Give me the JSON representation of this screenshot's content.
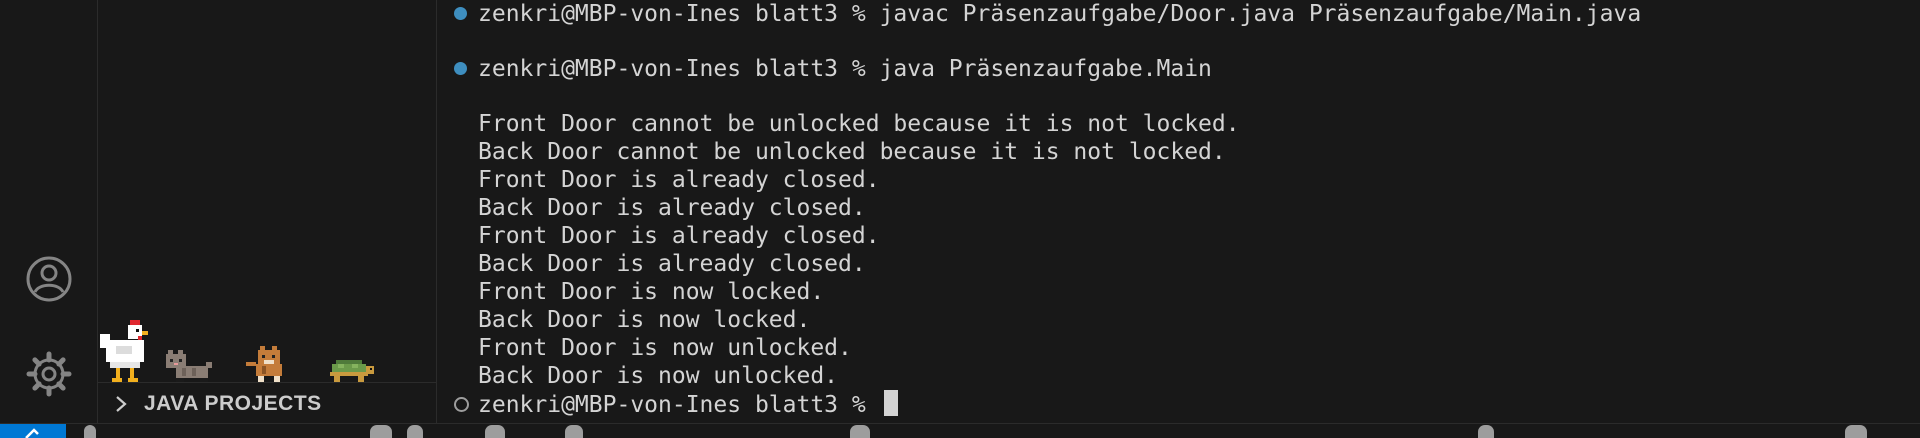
{
  "sidebar": {
    "section_title": "JAVA PROJECTS"
  },
  "terminal": {
    "lines": [
      {
        "decoration": "done",
        "text": "zenkri@MBP-von-Ines blatt3 % javac Präsenzaufgabe/Door.java Präsenzaufgabe/Main.java"
      },
      {
        "decoration": "done",
        "text": "zenkri@MBP-von-Ines blatt3 % java Präsenzaufgabe.Main"
      },
      {
        "decoration": "none",
        "text": "Front Door cannot be unlocked because it is not locked."
      },
      {
        "decoration": "none",
        "text": "Back Door cannot be unlocked because it is not locked."
      },
      {
        "decoration": "none",
        "text": "Front Door is already closed."
      },
      {
        "decoration": "none",
        "text": "Back Door is already closed."
      },
      {
        "decoration": "none",
        "text": "Front Door is already closed."
      },
      {
        "decoration": "none",
        "text": "Back Door is already closed."
      },
      {
        "decoration": "none",
        "text": "Front Door is now locked."
      },
      {
        "decoration": "none",
        "text": "Back Door is now locked."
      },
      {
        "decoration": "none",
        "text": "Front Door is now unlocked."
      },
      {
        "decoration": "none",
        "text": "Back Door is now unlocked."
      },
      {
        "decoration": "pending",
        "text": "zenkri@MBP-von-Ines blatt3 % "
      }
    ]
  },
  "icons": {
    "accounts": "account-icon",
    "manage": "gear-icon",
    "chevron": "chevron-right-icon",
    "remote": "remote-icon"
  },
  "colors": {
    "background": "#181818",
    "text": "#d4d4d4",
    "decoration_done": "#3e8ebf",
    "accent": "#0078d4"
  }
}
